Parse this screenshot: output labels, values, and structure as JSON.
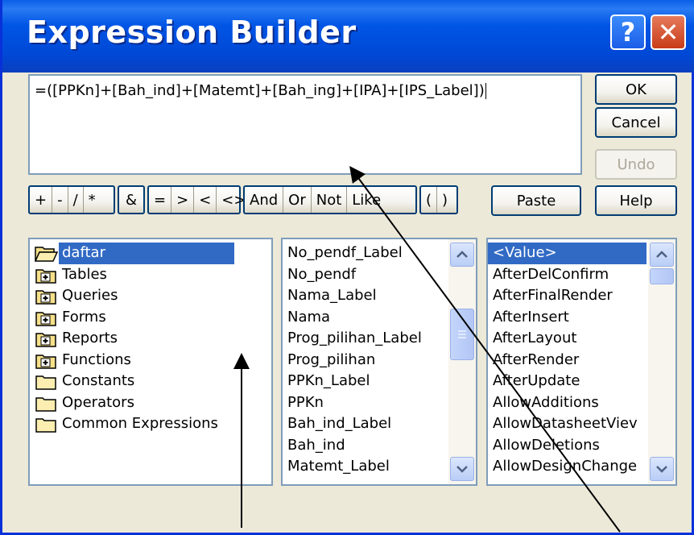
{
  "window": {
    "title": "Expression Builder",
    "help_label": "?",
    "close_label": "✕"
  },
  "expression": {
    "text": "=([PPKn]+[Bah_ind]+[Matemt]+[Bah_ing]+[IPA]+[IPS_Label])"
  },
  "buttons": {
    "ok": "OK",
    "cancel": "Cancel",
    "undo": "Undo",
    "paste": "Paste",
    "help": "Help"
  },
  "operators": {
    "arith": [
      "+",
      "-",
      "/",
      "*"
    ],
    "concat": [
      "&"
    ],
    "compare": [
      "=",
      ">",
      "<",
      "<>"
    ],
    "logic": [
      "And",
      "Or",
      "Not",
      "Like"
    ],
    "paren": [
      "(",
      ")"
    ]
  },
  "folders": [
    {
      "label": "daftar",
      "icon": "open-folder-icon",
      "selected": true
    },
    {
      "label": "Tables",
      "icon": "plus-folder-icon"
    },
    {
      "label": "Queries",
      "icon": "plus-folder-icon"
    },
    {
      "label": "Forms",
      "icon": "plus-folder-icon"
    },
    {
      "label": "Reports",
      "icon": "plus-folder-icon"
    },
    {
      "label": "Functions",
      "icon": "plus-folder-icon"
    },
    {
      "label": "Constants",
      "icon": "folder-icon"
    },
    {
      "label": "Operators",
      "icon": "folder-icon"
    },
    {
      "label": "Common Expressions",
      "icon": "folder-icon"
    }
  ],
  "fields": [
    "No_pendf_Label",
    "No_pendf",
    "Nama_Label",
    "Nama",
    "Prog_pilihan_Label",
    "Prog_pilihan",
    "PPKn_Label",
    "PPKn",
    "Bah_ind_Label",
    "Bah_ind",
    "Matemt_Label"
  ],
  "properties": [
    "<Value>",
    "AfterDelConfirm",
    "AfterFinalRender",
    "AfterInsert",
    "AfterLayout",
    "AfterRender",
    "AfterUpdate",
    "AllowAdditions",
    "AllowDatasheetViev",
    "AllowDeletions",
    "AllowDesignChange"
  ],
  "colors": {
    "titlebar": "#0055e5",
    "selection": "#316ac5",
    "face": "#ece9d8"
  }
}
